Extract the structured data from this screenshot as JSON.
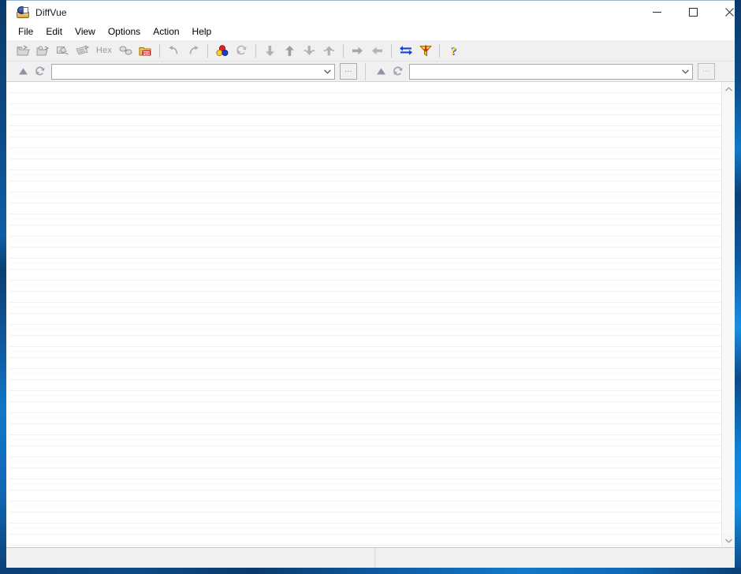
{
  "window": {
    "title": "DiffVue",
    "app_icon": "diffvue-app-icon",
    "border_color": "#0b3c6e",
    "controls": [
      {
        "name": "minimize",
        "glyph": "minimize-icon",
        "label": "Minimize"
      },
      {
        "name": "maximize",
        "glyph": "maximize-icon",
        "label": "Maximize"
      },
      {
        "name": "close",
        "glyph": "close-icon",
        "label": "Close"
      }
    ]
  },
  "menubar": {
    "items": [
      {
        "label": "File"
      },
      {
        "label": "Edit"
      },
      {
        "label": "View"
      },
      {
        "label": "Options"
      },
      {
        "label": "Action"
      },
      {
        "label": "Help"
      }
    ]
  },
  "toolbar": {
    "groups": [
      {
        "buttons": [
          {
            "name": "open-folder-compare",
            "icon": "open-folder-icon",
            "enabled": false
          },
          {
            "name": "open-file-compare",
            "icon": "open-file-pair-icon",
            "enabled": false
          },
          {
            "name": "open-image-compare",
            "icon": "open-image-icon",
            "enabled": false
          },
          {
            "name": "open-binary-compare",
            "icon": "open-binary-icon",
            "enabled": false
          },
          {
            "name": "hex-compare",
            "icon": "hex-text-icon",
            "enabled": false,
            "text": "Hex"
          },
          {
            "name": "link-compare",
            "icon": "link-compare-icon",
            "enabled": false
          },
          {
            "name": "pdf-compare",
            "icon": "pdf-folder-icon",
            "enabled": true
          }
        ]
      },
      {
        "buttons": [
          {
            "name": "undo",
            "icon": "undo-arrow-icon",
            "enabled": false
          },
          {
            "name": "redo",
            "icon": "redo-arrow-icon",
            "enabled": false
          }
        ]
      },
      {
        "buttons": [
          {
            "name": "color-options",
            "icon": "color-circles-icon",
            "enabled": true
          },
          {
            "name": "refresh",
            "icon": "refresh-icon",
            "enabled": false
          }
        ]
      },
      {
        "buttons": [
          {
            "name": "next-difference",
            "icon": "arrow-down-icon",
            "enabled": false
          },
          {
            "name": "previous-difference",
            "icon": "arrow-up-icon",
            "enabled": false
          },
          {
            "name": "last-difference",
            "icon": "arrow-down-bar-icon",
            "enabled": false
          },
          {
            "name": "first-difference",
            "icon": "arrow-up-bar-icon",
            "enabled": false
          }
        ]
      },
      {
        "buttons": [
          {
            "name": "copy-right",
            "icon": "arrow-right-icon",
            "enabled": false
          },
          {
            "name": "copy-left",
            "icon": "arrow-left-icon",
            "enabled": false
          }
        ]
      },
      {
        "buttons": [
          {
            "name": "swap-panes",
            "icon": "swap-arrows-icon",
            "enabled": true
          },
          {
            "name": "filter",
            "icon": "filter-funnel-icon",
            "enabled": true
          }
        ]
      },
      {
        "buttons": [
          {
            "name": "help",
            "icon": "help-question-icon",
            "enabled": true
          }
        ]
      }
    ]
  },
  "pathbar": {
    "left": {
      "scroll_up_icon": "triangle-up-icon",
      "refresh_icon": "refresh-icon",
      "combo_value": "",
      "combo_placeholder": "",
      "dropdown_icon": "chevron-down-icon",
      "browse_label": "...",
      "browse_enabled": true
    },
    "right": {
      "scroll_up_icon": "triangle-up-icon",
      "refresh_icon": "refresh-icon",
      "combo_value": "",
      "combo_placeholder": "",
      "dropdown_icon": "chevron-down-icon",
      "browse_label": "...",
      "browse_enabled": false
    }
  },
  "content": {
    "left_pane_text": "",
    "right_pane_text": "",
    "row_line_color": "#eef0f4",
    "background": "#ffffff"
  },
  "scrollbar": {
    "up_arrow_icon": "chevron-up-icon",
    "down_arrow_icon": "chevron-down-icon",
    "thumb_visible": false
  },
  "statusbar": {
    "pane_1": "",
    "pane_2": "",
    "grip_icon": "resize-grip-icon"
  }
}
